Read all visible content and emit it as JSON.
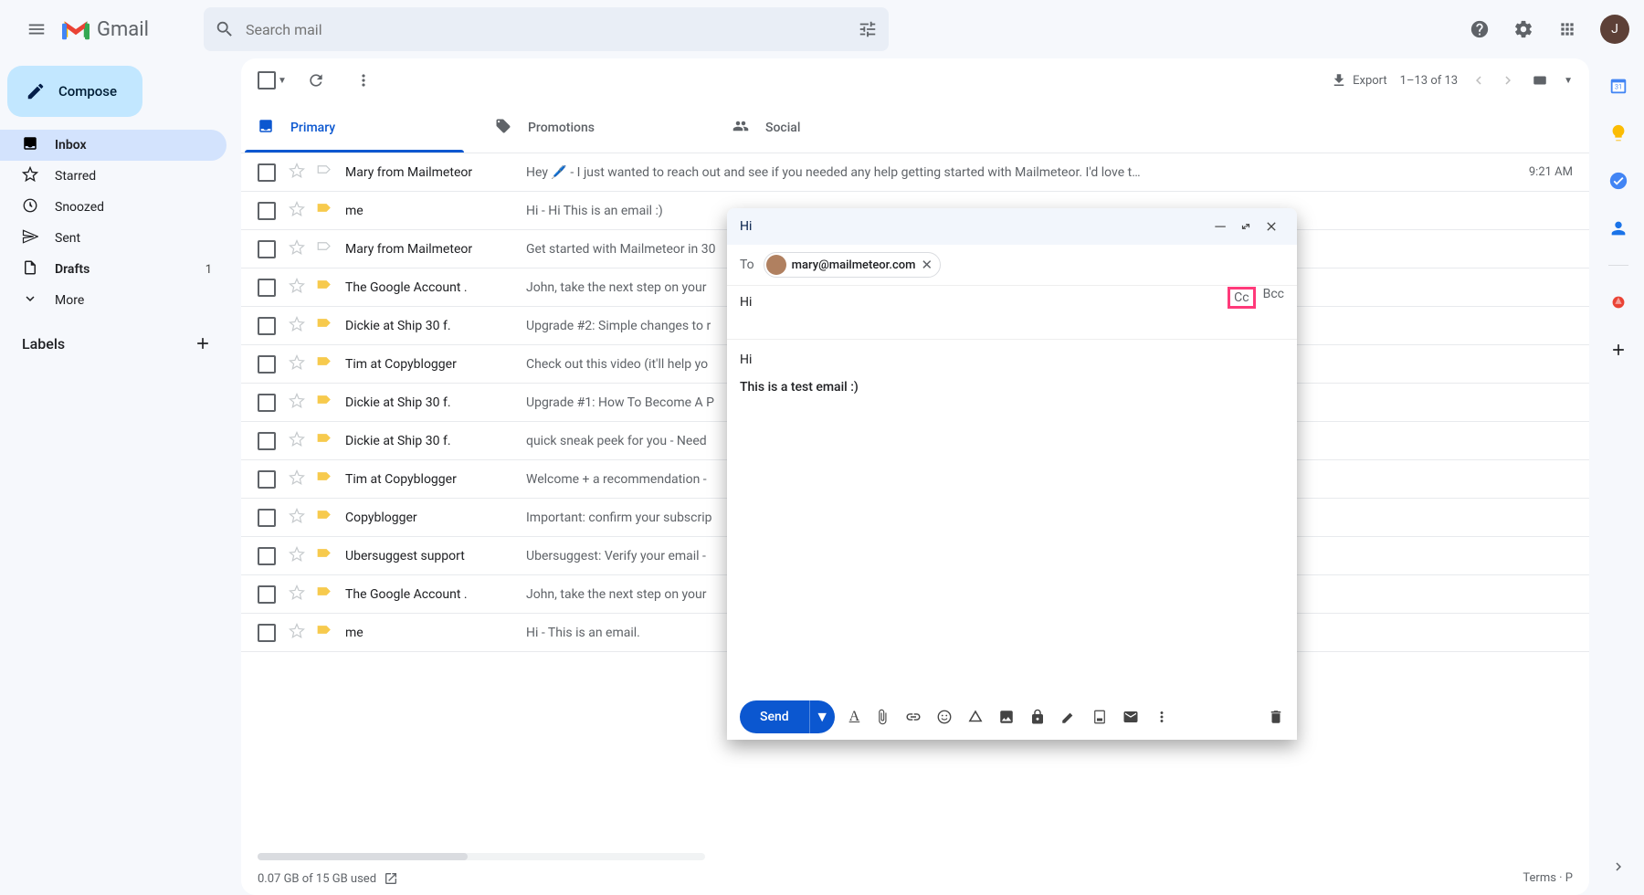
{
  "app": {
    "name": "Gmail"
  },
  "search": {
    "placeholder": "Search mail"
  },
  "header": {
    "avatarLetter": "J"
  },
  "compose_button": "Compose",
  "nav": [
    {
      "icon": "inbox",
      "label": "Inbox",
      "active": true
    },
    {
      "icon": "star",
      "label": "Starred"
    },
    {
      "icon": "clock",
      "label": "Snoozed"
    },
    {
      "icon": "send",
      "label": "Sent"
    },
    {
      "icon": "draft",
      "label": "Drafts",
      "count": "1"
    },
    {
      "icon": "more",
      "label": "More"
    }
  ],
  "labels_title": "Labels",
  "toolbar": {
    "export": "Export",
    "range": "1–13 of 13"
  },
  "tabs": [
    {
      "icon": "inbox",
      "label": "Primary",
      "active": true
    },
    {
      "icon": "tag",
      "label": "Promotions"
    },
    {
      "icon": "people",
      "label": "Social"
    }
  ],
  "emails": [
    {
      "sender": "Mary from Mailmeteor",
      "important": false,
      "subject": "Hey 🖊️  -  I just wanted to reach out and see if you needed any help getting started with Mailmeteor. I'd love t…",
      "time": "9:21 AM"
    },
    {
      "sender": "me",
      "important": true,
      "subject": "Hi  -  Hi This is an email :)",
      "time": ""
    },
    {
      "sender": "Mary from Mailmeteor",
      "important": false,
      "subject": "Get started with Mailmeteor in 30",
      "time": ""
    },
    {
      "sender": "The Google Account .",
      "important": true,
      "subject": "John, take the next step on your",
      "time": ""
    },
    {
      "sender": "Dickie at Ship 30 f.",
      "important": true,
      "subject": "Upgrade #2: Simple changes to r",
      "time": ""
    },
    {
      "sender": "Tim at Copyblogger",
      "important": true,
      "subject": "Check out this video (it'll help yo",
      "time": ""
    },
    {
      "sender": "Dickie at Ship 30 f.",
      "important": true,
      "subject": "Upgrade #1: How To Become A P",
      "time": ""
    },
    {
      "sender": "Dickie at Ship 30 f.",
      "important": true,
      "subject": "quick sneak peek for you  -  Need",
      "time": ""
    },
    {
      "sender": "Tim at Copyblogger",
      "important": true,
      "subject": "Welcome + a recommendation  - ",
      "time": ""
    },
    {
      "sender": "Copyblogger",
      "important": true,
      "subject": "Important: confirm your subscrip",
      "time": ""
    },
    {
      "sender": "Ubersuggest support",
      "important": true,
      "subject": "Ubersuggest: Verify your email  - ",
      "time": ""
    },
    {
      "sender": "The Google Account .",
      "important": true,
      "subject": "John, take the next step on your",
      "time": ""
    },
    {
      "sender": "me",
      "important": true,
      "subject": "Hi  -  This is an email.",
      "time": ""
    }
  ],
  "footer": {
    "storage": "0.07 GB of 15 GB used",
    "terms": "Terms · P"
  },
  "compose": {
    "title": "Hi",
    "to_label": "To",
    "recipient": "mary@mailmeteor.com",
    "cc": "Cc",
    "bcc": "Bcc",
    "subject": "Hi",
    "body_line1": "Hi",
    "body_line2": "This is a test email :)",
    "send": "Send"
  }
}
